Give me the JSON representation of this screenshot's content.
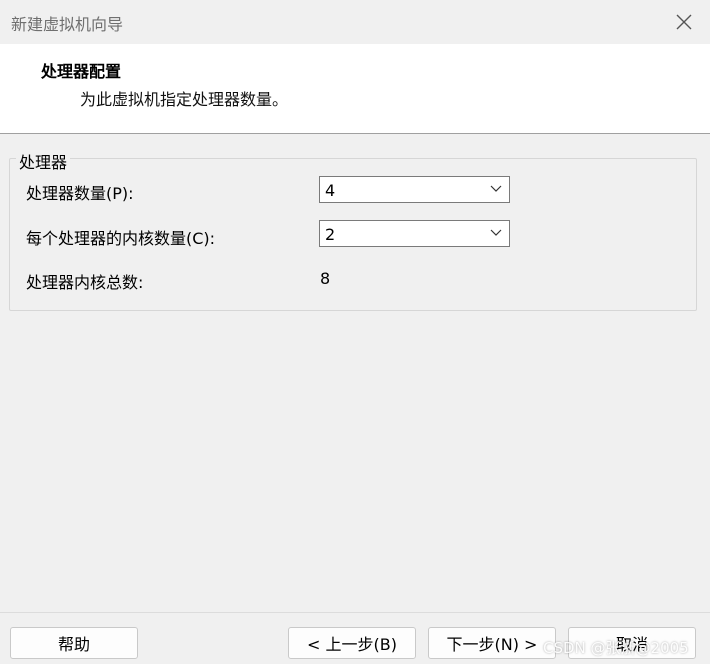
{
  "window": {
    "title": "新建虚拟机向导",
    "close_icon": "close-icon"
  },
  "header": {
    "title": "处理器配置",
    "subtitle": "为此虚拟机指定处理器数量。"
  },
  "processor_group": {
    "legend": "处理器",
    "processor_count": {
      "label": "处理器数量(P):",
      "value": "4"
    },
    "cores_per_processor": {
      "label": "每个处理器的内核数量(C):",
      "value": "2"
    },
    "total_cores": {
      "label": "处理器内核总数:",
      "value": "8"
    }
  },
  "footer": {
    "help_label": "帮助",
    "back_label": "< 上一步(B)",
    "next_label": "下一步(N) >",
    "cancel_label": "取消"
  },
  "watermark": "CSDN @张浙@2005"
}
